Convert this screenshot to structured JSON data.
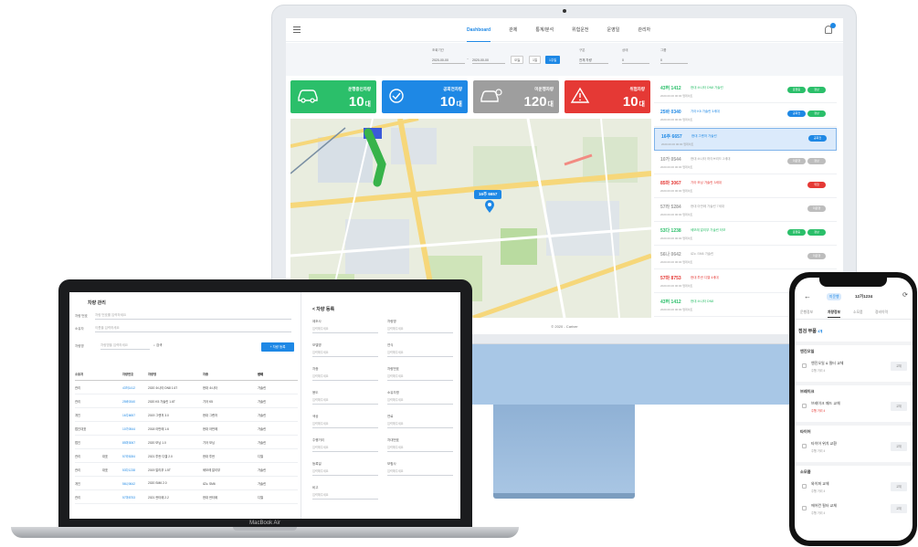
{
  "colors": {
    "accent": "#1e88e5",
    "green": "#2bbf6a",
    "gray": "#9e9e9e",
    "red": "#e53935"
  },
  "dashboard": {
    "nav": [
      "Dashboard",
      "관제",
      "통계/분석",
      "위험운전",
      "운영일",
      "관리자"
    ],
    "filters": {
      "period_label": "조회기간",
      "date_from": "2020-00-00",
      "date_to": "2020-00-00",
      "quick": [
        "오늘",
        "1일",
        "1주일"
      ],
      "type_label": "구분",
      "type_value": "전체 차량",
      "status_label": "상태",
      "status_value": "0",
      "group_label": "그룹",
      "group_value": "0"
    },
    "stats": [
      {
        "label": "운행중인차량",
        "value": "10",
        "unit": "대",
        "icon": "car-icon"
      },
      {
        "label": "공회전차량",
        "value": "10",
        "unit": "대",
        "icon": "check-circle-icon"
      },
      {
        "label": "미운행차량",
        "value": "120",
        "unit": "대",
        "icon": "parked-car-icon"
      },
      {
        "label": "위험차량",
        "value": "10",
        "unit": "대",
        "icon": "warning-icon"
      }
    ],
    "map_tooltip": "16주 6657",
    "footer": "© 2020 - Cariver",
    "vehicles": [
      {
        "plate": "43허 1412",
        "desc": "현대 소나타 DN8 가솔린",
        "sub": "2020.00.00 00:00 업데이트",
        "color": "#2bbf6a",
        "badges": [
          [
            "운행중",
            "#2bbf6a"
          ],
          [
            "정상",
            "#2bbf6a"
          ]
        ]
      },
      {
        "plate": "25바 0340",
        "desc": "기아 K5 가솔린 3세대",
        "sub": "2020.00.00 00:00 업데이트",
        "color": "#1e88e5",
        "badges": [
          [
            "공회전",
            "#1e88e5"
          ],
          [
            "정상",
            "#2bbf6a"
          ]
        ]
      },
      {
        "plate": "16주 6657",
        "desc": "현대 그랜저 가솔린",
        "sub": "2020.00.00 00:00 업데이트",
        "color": "#1e88e5",
        "badges": [
          [
            "공회전",
            "#1e88e5"
          ]
        ]
      },
      {
        "plate": "10가 0544",
        "desc": "현대 소나타 하이브리드 2세대",
        "sub": "2020.00.00 00:00 업데이트",
        "color": "#9e9e9e",
        "badges": [
          [
            "미운행",
            "#bdbdbd"
          ],
          [
            "정상",
            "#bdbdbd"
          ]
        ]
      },
      {
        "plate": "85마 3067",
        "desc": "기아 모닝 가솔린 3세대",
        "sub": "2020.00.00 00:00 업데이트",
        "color": "#e53935",
        "badges": [
          [
            "위험",
            "#e53935"
          ]
        ]
      },
      {
        "plate": "57라 5284",
        "desc": "현대 아반떼 가솔린 7세대",
        "sub": "2020.00.00 00:00 업데이트",
        "color": "#9e9e9e",
        "badges": [
          [
            "미운행",
            "#bdbdbd"
          ]
        ]
      },
      {
        "plate": "53다 1238",
        "desc": "쉐보레 말리부 가솔린 터보",
        "sub": "2020.00.00 00:00 업데이트",
        "color": "#2bbf6a",
        "badges": [
          [
            "운행중",
            "#2bbf6a"
          ],
          [
            "정상",
            "#2bbf6a"
          ]
        ]
      },
      {
        "plate": "56나 0642",
        "desc": "르노 SM6 가솔린",
        "sub": "2020.00.00 00:00 업데이트",
        "color": "#9e9e9e",
        "badges": [
          [
            "미운행",
            "#bdbdbd"
          ]
        ]
      },
      {
        "plate": "57마 8753",
        "desc": "현대 투싼 디젤 4세대",
        "sub": "2020.00.00 00:00 업데이트",
        "color": "#e53935",
        "badges": [
          [
            "위험",
            "#e53935"
          ]
        ]
      },
      {
        "plate": "43허 1412",
        "desc": "현대 소나타 DN8",
        "sub": "2020.00.00 00:00 업데이트",
        "color": "#2bbf6a",
        "badges": []
      }
    ]
  },
  "laptop": {
    "brand": "MacBook Air",
    "left_title": "차량 관리",
    "search_label": "차량 번호",
    "search_placeholder": "차량 번호를 입력하세요",
    "owner_label": "소유자",
    "owner_placeholder": "이름을 입력하세요",
    "model_label": "차량명",
    "model_placeholder": "차량명을 입력하세요",
    "search_button": "검색",
    "add_button": "+ 차량 등록",
    "table_headers": [
      "소유자",
      "차량번호",
      "차량명",
      "차종",
      "연식",
      "상태"
    ],
    "table_rows": [
      [
        "관리",
        "",
        "43허1412",
        "2020 소나타 DN8 1.6T",
        "현대 소나타",
        "가솔린"
      ],
      [
        "관리",
        "",
        "25바0340",
        "2020 K5 가솔린 1.6T",
        "기아 K5",
        "가솔린"
      ],
      [
        "개인",
        "",
        "16주6657",
        "2019 그랜저 3.0",
        "현대 그랜저",
        "가솔린"
      ],
      [
        "법인대표",
        "",
        "10가0544",
        "2018 아반떼 1.6",
        "현대 아반떼",
        "가솔린"
      ],
      [
        "법인",
        "",
        "85마3067",
        "2020 모닝 1.0",
        "기아 모닝",
        "가솔린"
      ],
      [
        "관리",
        "대표",
        "57라5284",
        "2021 투싼 디젤 2.0",
        "현대 투싼",
        "디젤"
      ],
      [
        "관리",
        "대표",
        "53다1238",
        "2019 말리부 1.5T",
        "쉐보레 말리부",
        "가솔린"
      ],
      [
        "개인",
        "",
        "56나0642",
        "2020 SM6 2.0",
        "르노 SM6",
        "가솔린"
      ],
      [
        "관리",
        "",
        "57마8753",
        "2021 싼타페 2.2",
        "현대 싼타페",
        "디젤"
      ]
    ],
    "form_title": "< 차량 등록",
    "form_fields": [
      "제조사",
      "차량명",
      "모델명",
      "연식",
      "차종",
      "차량번호",
      "용도",
      "소유자명",
      "색상",
      "연료",
      "주행거리",
      "차대번호",
      "등록일",
      "보험사",
      "비고"
    ],
    "form_placeholder": "입력해주세요"
  },
  "phone": {
    "chip": "미운행",
    "plate": "12가1234",
    "tabs": [
      "운행정보",
      "차량정보",
      "소모품",
      "정비이력"
    ],
    "section_title": "점검 부품",
    "section_tag": "4개",
    "groups": [
      {
        "title": "엔진오일",
        "items": [
          {
            "name": "엔진오일 & 필터 교체",
            "sub": "주행 거리 4",
            "alert": false
          }
        ]
      },
      {
        "title": "브레이크",
        "items": [
          {
            "name": "브레이크 패드 교체",
            "sub": "주행 거리 4",
            "alert": true
          }
        ]
      },
      {
        "title": "타이어",
        "items": [
          {
            "name": "타이어 위치 교환",
            "sub": "주행 거리 4",
            "alert": false
          }
        ]
      },
      {
        "title": "소모품",
        "items": [
          {
            "name": "와이퍼 교체",
            "sub": "주행 거리 4",
            "alert": false
          },
          {
            "name": "에어컨 필터 교체",
            "sub": "주행 거리 4",
            "alert": false
          }
        ]
      }
    ],
    "item_button": "교체"
  }
}
